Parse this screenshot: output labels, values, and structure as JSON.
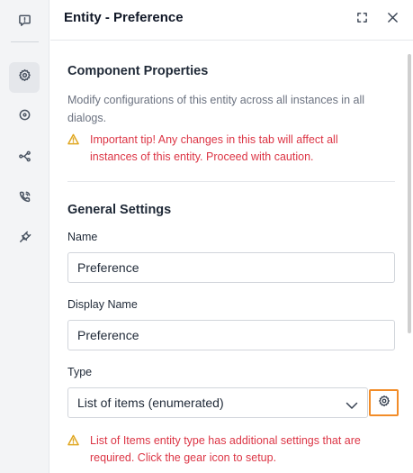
{
  "rail": {
    "items": [
      {
        "icon": "chat-alert-icon"
      },
      {
        "icon": "gear-icon"
      },
      {
        "icon": "target-icon"
      },
      {
        "icon": "flow-icon"
      },
      {
        "icon": "phone-icon"
      },
      {
        "icon": "plug-icon"
      }
    ]
  },
  "header": {
    "title": "Entity - Preference"
  },
  "component_properties": {
    "title": "Component Properties",
    "description": "Modify configurations of this entity across all instances in all dialogs.",
    "warning": "Important tip! Any changes in this tab will affect all instances of this entity. Proceed with caution."
  },
  "general_settings": {
    "title": "General Settings",
    "name_label": "Name",
    "name_value": "Preference",
    "display_name_label": "Display Name",
    "display_name_value": "Preference",
    "type_label": "Type",
    "type_value": "List of items (enumerated)",
    "type_warning": "List of Items entity type has additional settings that are required. Click the gear icon to setup."
  },
  "colors": {
    "warning_text": "#dc3545",
    "warning_icon": "#e0a722",
    "gear_highlight": "#f28c28"
  }
}
